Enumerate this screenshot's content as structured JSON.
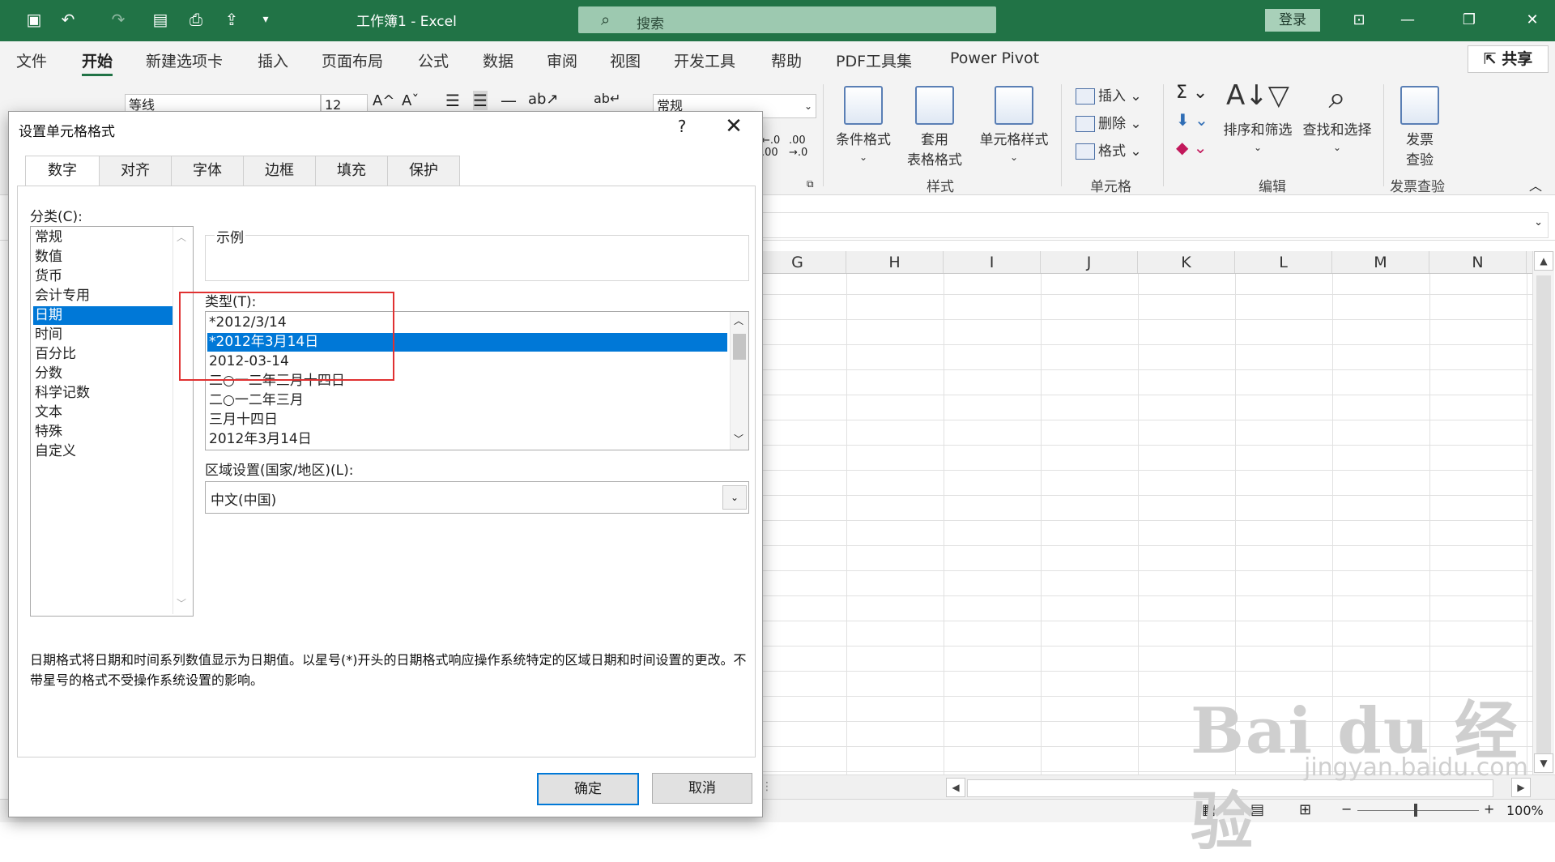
{
  "titlebar": {
    "doc_title": "工作簿1  -  Excel",
    "search_placeholder": "搜索",
    "login": "登录"
  },
  "menu": {
    "tabs": [
      "文件",
      "开始",
      "新建选项卡",
      "插入",
      "页面布局",
      "公式",
      "数据",
      "审阅",
      "视图",
      "开发工具",
      "帮助",
      "PDF工具集",
      "Power Pivot"
    ],
    "share": "共享"
  },
  "ribbon": {
    "font_name": "等线",
    "font_size": "12",
    "number_format": "常规",
    "conditional_format": "条件格式",
    "table_format_1": "套用",
    "table_format_2": "表格格式",
    "cell_styles": "单元格样式",
    "styles_group": "样式",
    "insert": "插入",
    "delete": "删除",
    "format": "格式",
    "cells_group": "单元格",
    "sort_filter": "排序和筛选",
    "find_select": "查找和选择",
    "editing_group": "编辑",
    "invoice_1": "发票",
    "invoice_2": "查验",
    "invoice_group": "发票查验"
  },
  "grid": {
    "columns": [
      "G",
      "H",
      "I",
      "J",
      "K",
      "L",
      "M",
      "N"
    ]
  },
  "statusbar": {
    "zoom": "100%"
  },
  "dialog": {
    "title": "设置单元格格式",
    "help": "?",
    "close": "✕",
    "tabs": [
      "数字",
      "对齐",
      "字体",
      "边框",
      "填充",
      "保护"
    ],
    "category_label": "分类(C):",
    "categories": [
      "常规",
      "数值",
      "货币",
      "会计专用",
      "日期",
      "时间",
      "百分比",
      "分数",
      "科学记数",
      "文本",
      "特殊",
      "自定义"
    ],
    "selected_category": "日期",
    "sample_label": "示例",
    "type_label": "类型(T):",
    "types": [
      "*2012/3/14",
      "*2012年3月14日",
      "2012-03-14",
      "二○一二年三月十四日",
      "二○一二年三月",
      "三月十四日",
      "2012年3月14日"
    ],
    "selected_type": "*2012年3月14日",
    "locale_label": "区域设置(国家/地区)(L):",
    "locale_value": "中文(中国)",
    "description": "日期格式将日期和时间系列数值显示为日期值。以星号(*)开头的日期格式响应操作系统特定的区域日期和时间设置的更改。不带星号的格式不受操作系统设置的影响。",
    "ok": "确定",
    "cancel": "取消"
  },
  "watermark": {
    "brand": "Bai du 经验",
    "url": "jingyan.baidu.com"
  },
  "colors": {
    "excel_green": "#217346",
    "selection_blue": "#0078d7",
    "annotation_red": "#e03131"
  }
}
